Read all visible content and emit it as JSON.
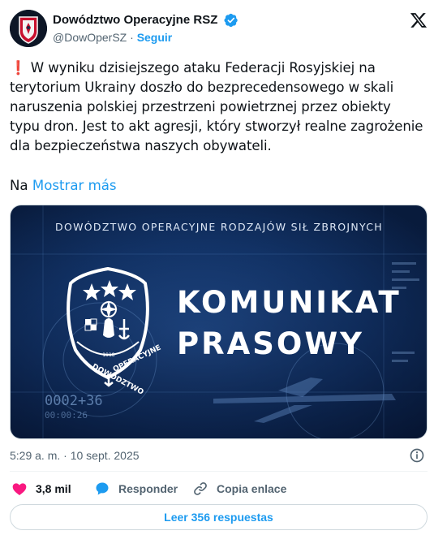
{
  "account": {
    "display_name": "Dowództwo Operacyjne RSZ",
    "handle": "@DowOperSZ",
    "separator": "·",
    "follow_label": "Seguir"
  },
  "tweet": {
    "alert_glyph": "❗",
    "text": "W wyniku dzisiejszego ataku Federacji Rosyjskiej na terytorium Ukrainy doszło do bezprecedensowego w skali naruszenia polskiej przestrzeni powietrznej przez obiekty typu dron. Jest to akt agresji, który stworzył realne zagrożenie dla bezpieczeństwa naszych obywateli.",
    "truncated_prefix": "Na",
    "show_more_label": "Mostrar más",
    "timestamp": "5:29 a. m. · 10 sept. 2025"
  },
  "media": {
    "banner_title": "DOWÓDZTWO OPERACYJNE RODZAJÓW SIŁ ZBROJNYCH",
    "headline_line1": "KOMUNIKAT",
    "headline_line2": "PRASOWY",
    "emblem_text_left": "DOWÓDZTWO",
    "emblem_text_right": "OPERACYJNE",
    "emblem_year": "1918",
    "hud_number_1": "0002+36",
    "hud_number_2": "00:00:26"
  },
  "actions": {
    "like_count": "3,8 mil",
    "reply_label": "Responder",
    "copy_label": "Copia enlace",
    "read_replies_label": "Leer 356 respuestas"
  },
  "colors": {
    "accent": "#1d9bf0",
    "like": "#f91880",
    "text": "#0f1419",
    "muted": "#536471"
  },
  "icons": [
    "avatar-emblem",
    "verified-badge-icon",
    "x-logo-icon",
    "info-icon",
    "heart-icon",
    "reply-bubble-icon",
    "link-icon"
  ]
}
